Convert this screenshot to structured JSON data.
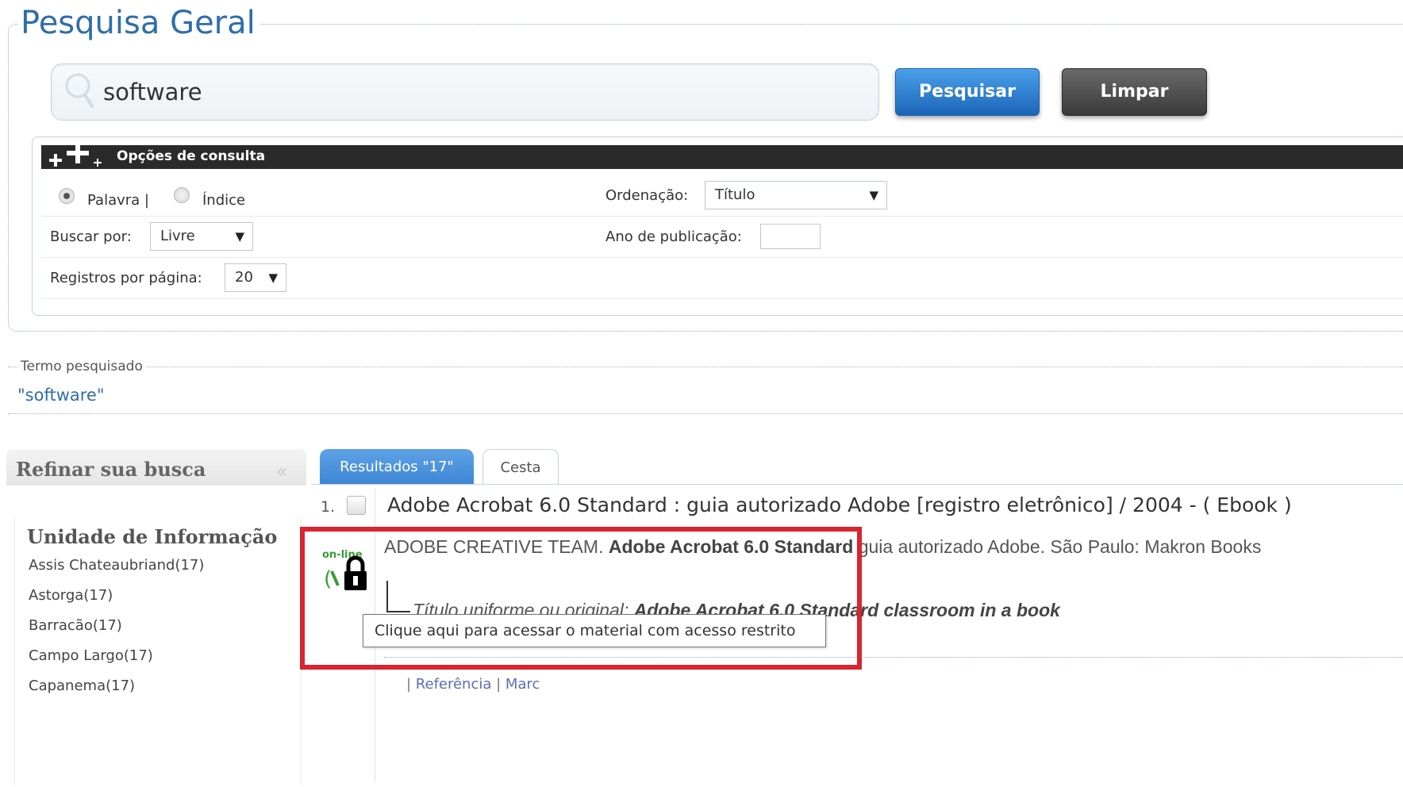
{
  "search_panel": {
    "legend": "Pesquisa Geral",
    "query": "software",
    "search_button": "Pesquisar",
    "clear_button": "Limpar"
  },
  "options": {
    "title": "Opções de consulta",
    "radio_word": "Palavra |",
    "radio_index": "Índice",
    "radio_selected": "Palavra",
    "order_label": "Ordenação:",
    "order_value": "Título",
    "search_by_label": "Buscar por:",
    "search_by_value": "Livre",
    "year_label": "Ano de publicação:",
    "year_value": "",
    "per_page_label": "Registros por página:",
    "per_page_value": "20"
  },
  "term": {
    "legend": "Termo pesquisado",
    "value": "\"software\""
  },
  "sidebar": {
    "title": "Refinar sua busca",
    "collapse_glyph": "«",
    "section_title": "Unidade de Informação",
    "units": [
      "Assis Chateaubriand(17)",
      "Astorga(17)",
      "Barracão(17)",
      "Campo Largo(17)",
      "Capanema(17)"
    ]
  },
  "tabs": {
    "results": "Resultados \"17\"",
    "basket": "Cesta"
  },
  "result": {
    "number": "1.",
    "title": "Adobe Acrobat 6.0 Standard : guia autorizado Adobe [registro eletrônico] / 2004 - ( Ebook )",
    "author": "ADOBE CREATIVE TEAM.",
    "author_title": "Adobe Acrobat 6.0 Standard",
    "author_rest": "guia autorizado Adobe. São Paulo: Makron Books",
    "online_label": "on-line",
    "uniform_label": "Título uniforme ou original:",
    "uniform_value": "Adobe Acrobat 6.0 Standard classroom in a book",
    "tooltip": "Clique aqui para acessar o material com acesso restrito",
    "link_ref": "Referência",
    "link_marc": "Marc"
  },
  "colors": {
    "brand_blue": "#2f6ea8",
    "highlight_red": "#d9252f",
    "tab_blue": "#4a93dc"
  }
}
